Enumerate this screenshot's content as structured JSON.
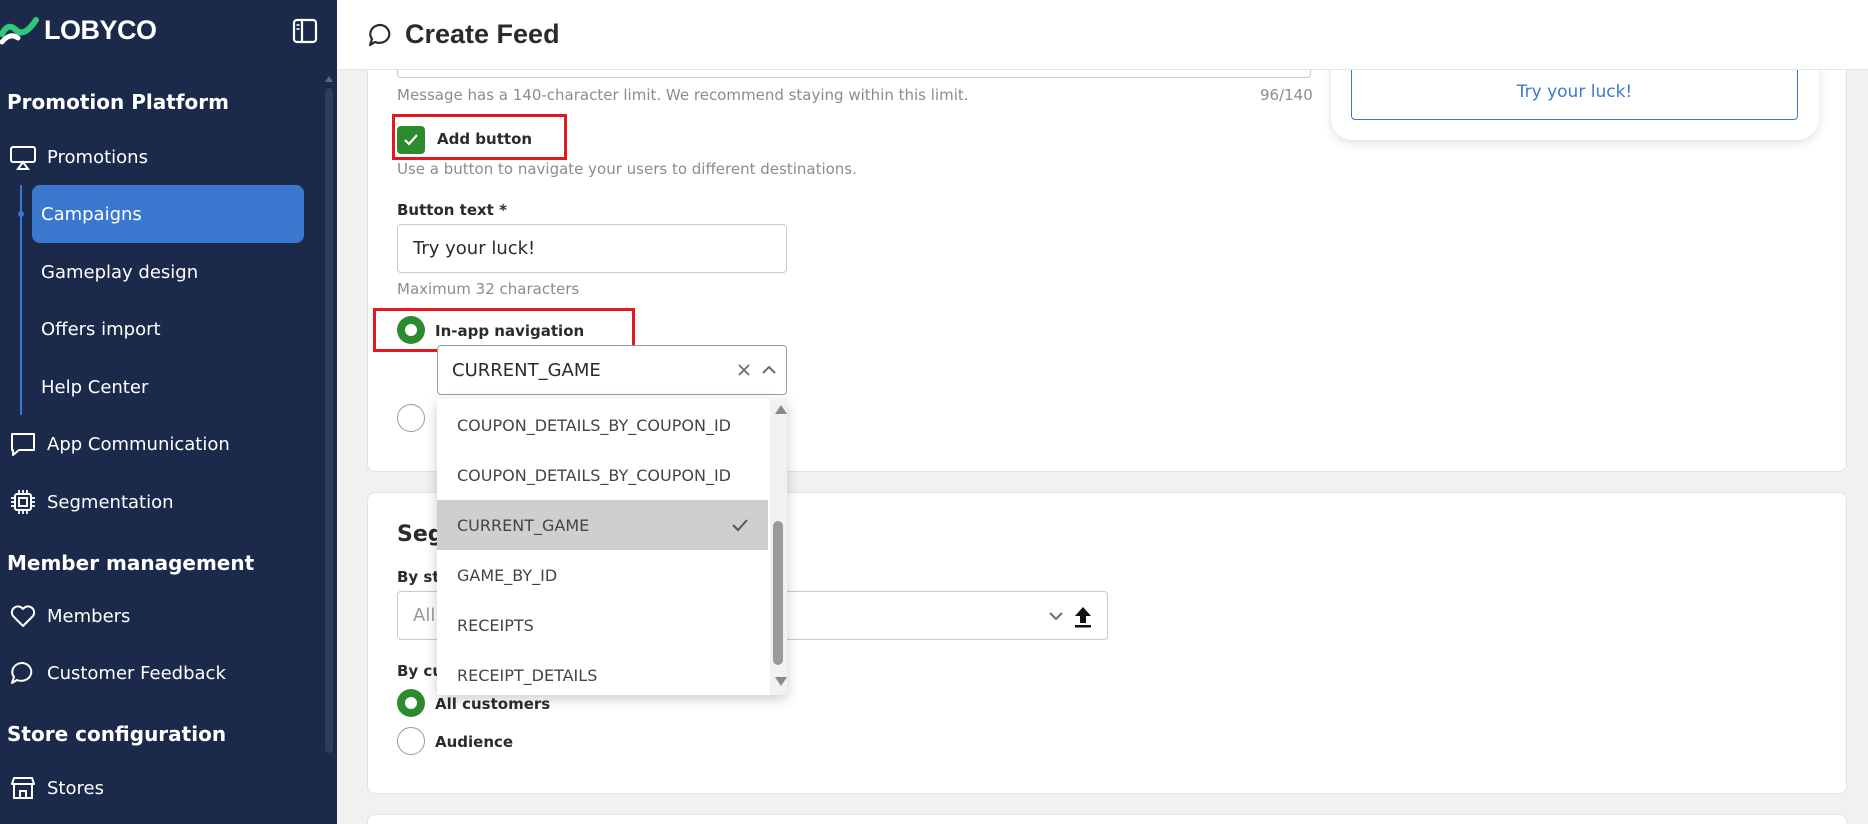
{
  "brand": {
    "name": "LOBYCO"
  },
  "sidebar": {
    "sections": [
      {
        "title": "Promotion Platform"
      },
      {
        "title": "Member management"
      },
      {
        "title": "Store configuration"
      }
    ],
    "promotions": {
      "label": "Promotions",
      "icon": "presentation-icon"
    },
    "sub_items": [
      {
        "label": "Campaigns",
        "active": true
      },
      {
        "label": "Gameplay design"
      },
      {
        "label": "Offers import"
      },
      {
        "label": "Help Center"
      }
    ],
    "app_communication": {
      "label": "App Communication",
      "icon": "chat-square-icon"
    },
    "segmentation": {
      "label": "Segmentation",
      "icon": "chip-icon"
    },
    "members": {
      "label": "Members",
      "icon": "heart-icon"
    },
    "customer_feedback": {
      "label": "Customer Feedback",
      "icon": "chat-bubble-icon"
    },
    "stores": {
      "label": "Stores",
      "icon": "store-icon"
    }
  },
  "header": {
    "title": "Create Feed",
    "icon": "chat-bubble-icon"
  },
  "form": {
    "message_helper": "Message has a 140-character limit. We recommend staying within this limit.",
    "message_counter": "96/140",
    "add_button_label": "Add button",
    "add_button_helper": "Use a button to navigate your users to different destinations.",
    "button_text_label": "Button text *",
    "button_text_value": "Try your luck!",
    "button_text_helper": "Maximum 32 characters",
    "in_app_nav_label": "In-app navigation",
    "nav_combo_value": "CURRENT_GAME"
  },
  "dropdown": {
    "options": [
      {
        "label": "COUPON_DETAILS_BY_COUPON_ID"
      },
      {
        "label": "COUPON_DETAILS_BY_COUPON_ID"
      },
      {
        "label": "CURRENT_GAME",
        "selected": true
      },
      {
        "label": "GAME_BY_ID"
      },
      {
        "label": "RECEIPTS"
      },
      {
        "label": "RECEIPT_DETAILS"
      }
    ]
  },
  "preview": {
    "button_label": "Try your luck!"
  },
  "segmentation_card": {
    "title_partial": "Seg",
    "store_label_partial": "By st",
    "store_placeholder_partial": "All",
    "customer_label_partial": "By cu",
    "options": [
      {
        "label": "All customers",
        "selected": true
      },
      {
        "label": "Audience",
        "selected": false
      }
    ]
  },
  "colors": {
    "sidebar_bg": "#1b2a4a",
    "accent": "#3a78d0",
    "success": "#2c8a2f",
    "highlight": "#e2171f"
  }
}
